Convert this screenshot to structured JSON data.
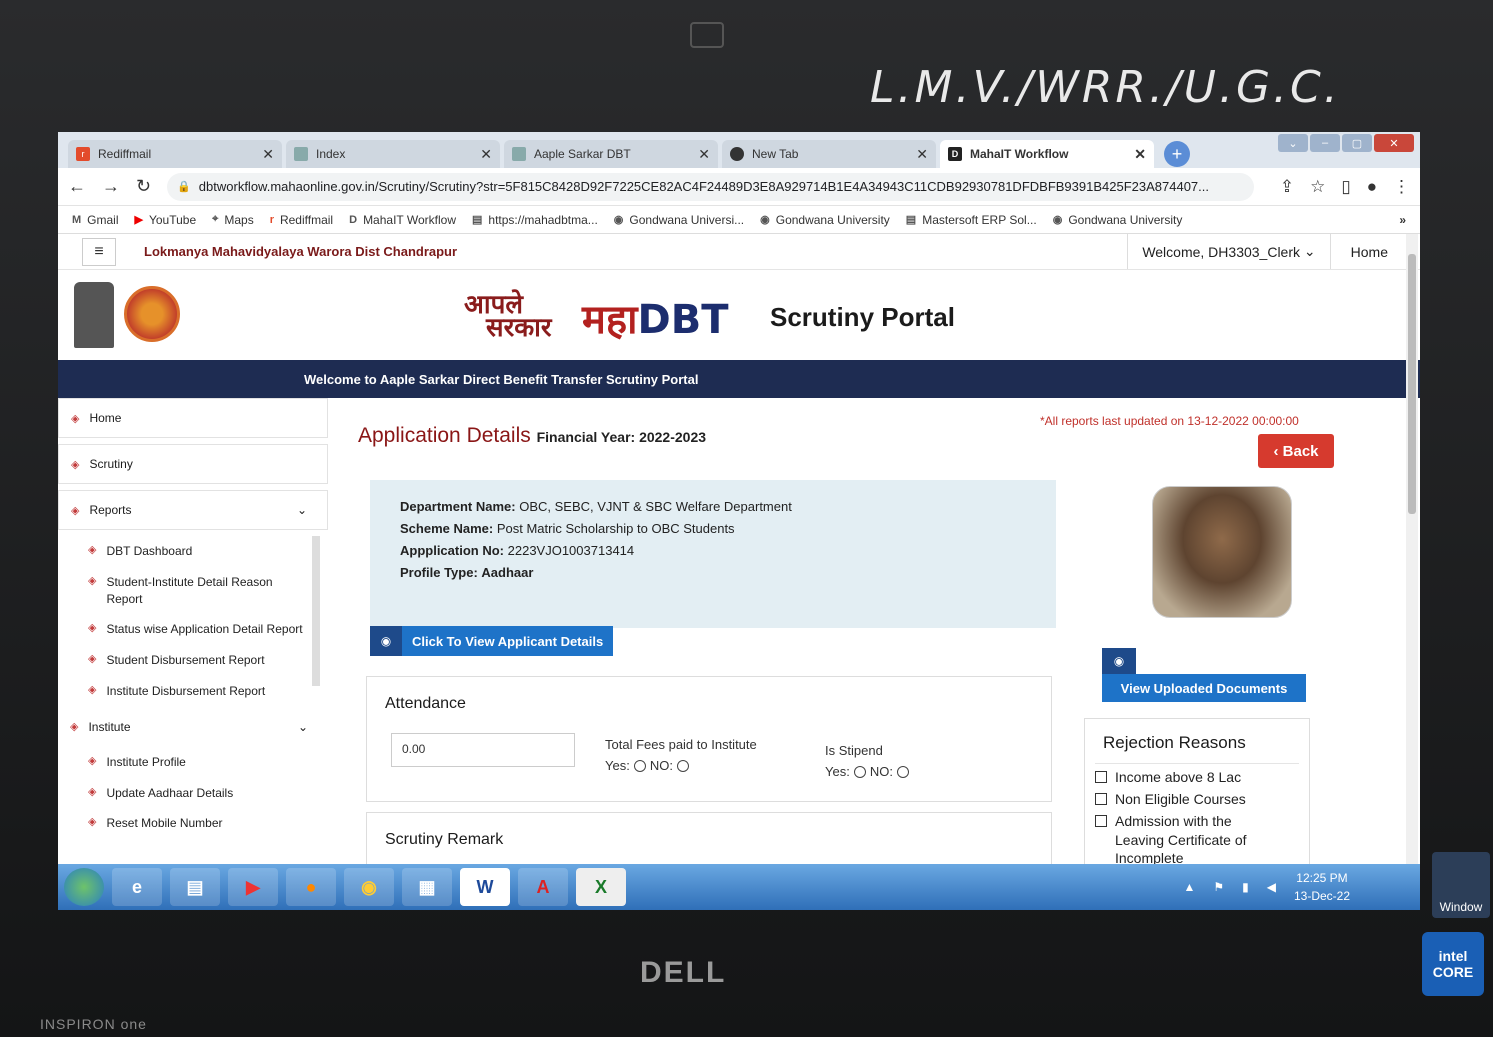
{
  "bezel_note": "L.M.V./WRR./U.G.C.",
  "browser": {
    "tabs": [
      {
        "label": "Rediffmail",
        "favicon": "rediffmail-icon"
      },
      {
        "label": "Index",
        "favicon": "document-icon"
      },
      {
        "label": "Aaple Sarkar DBT",
        "favicon": "document-icon"
      },
      {
        "label": "New Tab",
        "favicon": "chrome-icon"
      },
      {
        "label": "MahaIT Workflow",
        "favicon": "dbt-icon",
        "active": true
      }
    ],
    "url": "dbtworkflow.mahaonline.gov.in/Scrutiny/Scrutiny?str=5F815C8428D92F7225CE82AC4F24489D3E8A929714B1E4A34943C11CDB92930781DFDBFB9391B425F23A874407...",
    "bookmarks": [
      "Gmail",
      "YouTube",
      "Maps",
      "Rediffmail",
      "MahaIT Workflow",
      "https://mahadbtma...",
      "Gondwana Universi...",
      "Gondwana University",
      "Mastersoft ERP Sol...",
      "Gondwana University"
    ],
    "bookmarks_more": "»"
  },
  "header": {
    "college": "Lokmanya Mahavidyalaya Warora Dist Chandrapur",
    "welcome": "Welcome, DH3303_Clerk",
    "home": "Home",
    "logo_aaple_top": "आपले",
    "logo_aaple_bottom": "सरकार",
    "logo_maha": "महा",
    "logo_dbt": "DBT",
    "portal_title": "Scrutiny Portal",
    "banner": "Welcome to Aaple Sarkar Direct Benefit Transfer Scrutiny Portal"
  },
  "sidebar": {
    "home": "Home",
    "scrutiny": "Scrutiny",
    "reports": "Reports",
    "report_items": [
      "DBT Dashboard",
      "Student-Institute Detail Reason Report",
      "Status wise Application Detail Report",
      "Student Disbursement Report",
      "Institute Disbursement Report"
    ],
    "institute": "Institute",
    "institute_items": [
      "Institute Profile",
      "Update Aadhaar Details",
      "Reset Mobile Number"
    ]
  },
  "application": {
    "title": "Application Details",
    "fy_label": "Financial Year: 2022-2023",
    "updated_note": "*All reports last updated on 13-12-2022 00:00:00",
    "back": "Back",
    "dept_label": "Department Name:",
    "dept_value": "OBC, SEBC, VJNT & SBC Welfare Department",
    "scheme_label": "Scheme Name:",
    "scheme_value": "Post Matric Scholarship to OBC Students",
    "appno_label": "Appplication No:",
    "appno_value": "2223VJO1003713414",
    "profile_label": "Profile Type:",
    "profile_value": "Aadhaar",
    "view_applicant": "Click To View Applicant Details",
    "view_docs": "View Uploaded Documents"
  },
  "attendance": {
    "title": "Attendance",
    "value": "0.00",
    "fees_label": "Total Fees paid to Institute",
    "stipend_label": "Is Stipend",
    "yes": "Yes:",
    "no": "NO:"
  },
  "scrutiny_remark": {
    "title": "Scrutiny Remark"
  },
  "rejection": {
    "title": "Rejection Reasons",
    "items": [
      "Income above 8 Lac",
      "Non Eligible Courses",
      "Admission with the Leaving Certificate of Incomplete"
    ]
  },
  "taskbar": {
    "time": "12:25 PM",
    "date": "13-Dec-22",
    "apps": [
      "start-icon",
      "ie-icon",
      "explorer-icon",
      "media-icon",
      "firefox-icon",
      "chrome-icon",
      "calculator-icon",
      "word-icon",
      "acrobat-icon",
      "excel-icon"
    ]
  },
  "hardware": {
    "brand": "DELL",
    "model": "INSPIRON one",
    "intel": "intel",
    "intel_core": "CORE",
    "windows": "Window"
  }
}
